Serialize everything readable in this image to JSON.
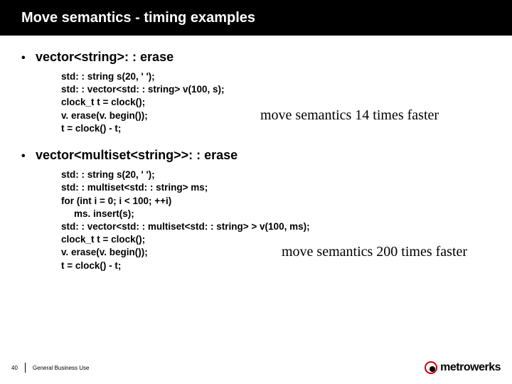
{
  "title": "Move semantics - timing examples",
  "section1": {
    "heading": "vector<string>: : erase",
    "code": [
      "std: : string s(20, ' ');",
      "std: : vector<std: : string> v(100, s);",
      "clock_t t = clock();",
      "v. erase(v. begin());",
      "t = clock() - t;"
    ],
    "callout": "move semantics 14 times faster"
  },
  "section2": {
    "heading": "vector<multiset<string>>: : erase",
    "code": [
      "std: : string s(20, ' ');",
      "std: : multiset<std: : string> ms;",
      "for (int i = 0; i < 100; ++i)",
      "ms. insert(s);",
      "std: : vector<std: : multiset<std: : string> > v(100, ms);",
      "clock_t t = clock();",
      "v. erase(v. begin());",
      "t = clock() - t;"
    ],
    "callout": "move semantics 200 times faster"
  },
  "footer": {
    "slide_number": "40",
    "classification": "General Business Use",
    "logo": "metrowerks"
  }
}
